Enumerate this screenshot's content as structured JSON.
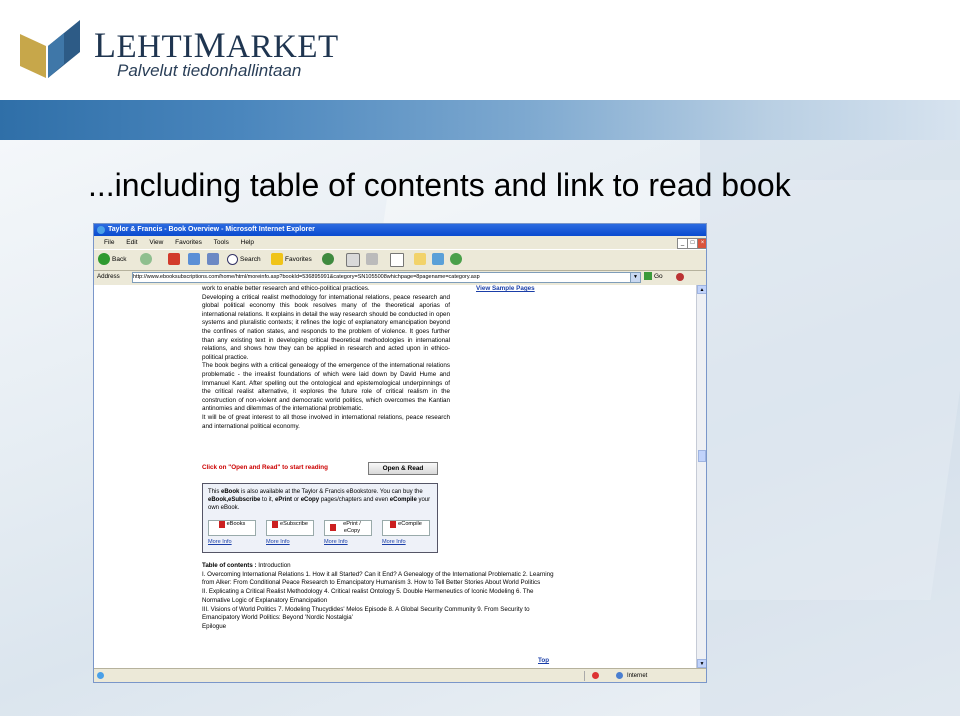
{
  "logo": {
    "brand": "LEHTIMARKET",
    "brand_first": "L",
    "brand_mid": "EHTI",
    "brand_second": "M",
    "brand_end": "ARKET",
    "tagline": "Palvelut tiedonhallintaan"
  },
  "slide": {
    "title": "...including table of contents and link to read book"
  },
  "browser": {
    "window_title": "Taylor & Francis - Book Overview - Microsoft Internet Explorer",
    "menu": [
      "File",
      "Edit",
      "View",
      "Favorites",
      "Tools",
      "Help"
    ],
    "toolbar": {
      "back": "Back",
      "search": "Search",
      "favorites": "Favorites"
    },
    "address_label": "Address",
    "url": "http://www.ebooksubscriptions.com/home/html/moreinfo.asp?bookId=536895991&category=SN1055008whichpage=8pagename=category.asp",
    "go_label": "Go",
    "status": {
      "zone": "Internet"
    }
  },
  "page": {
    "view_sample": "View Sample Pages",
    "description": [
      "work to enable better research and ethico-political practices.",
      "Developing a critical realist methodology for international relations, peace research and global political economy this book resolves many of the theoretical aporias of international relations. It explains in detail the way research should be conducted in open systems and pluralistic contexts; it refines the logic of explanatory emancipation beyond the confines of nation states, and responds to the problem of violence. It goes further than any existing text in developing critical theoretical methodologies in international relations, and shows how they can be applied in research and acted upon in ethico-political practice.",
      "The book begins with a critical genealogy of the emergence of the international relations problematic - the irrealist foundations of which were laid down by David Hume and Immanuel Kant. After spelling out the ontological and epistemological underpinnings of the critical realist alternative, it explores the future role of critical realism in the construction of non-violent and democratic world politics, which overcomes the Kantian antinomies and dilemmas of the international problematic.",
      "It will be of great interest to all those involved in international relations, peace research and international political economy."
    ],
    "open_read_prompt": "Click on \"Open and Read\" to start reading",
    "open_read_button": "Open & Read",
    "ebook_box": {
      "intro_1": "This ",
      "intro_ebook": "eBook",
      "intro_2": " is also available at the Taylor & Francis eBookstore. You can buy the ",
      "intro_bold": "eBook,eSubscribe",
      "intro_3": " to it, ",
      "intro_eprint": "ePrint",
      "intro_4": " or ",
      "intro_ecopy": "eCopy",
      "intro_5": " pages/chapters and even ",
      "intro_ecompile": "eCompile",
      "intro_6": " your own eBook.",
      "buttons": [
        {
          "label": "eBooks",
          "more": "More Info"
        },
        {
          "label": "eSubscribe",
          "more": "More Info"
        },
        {
          "label": "ePrint / eCopy",
          "more": "More Info"
        },
        {
          "label": "eCompile",
          "more": "More Info"
        }
      ]
    },
    "toc_heading": "Table of contents : ",
    "toc_intro": "Introduction",
    "toc_lines": [
      "I. Overcoming International Relations 1. How it all Started? Can it End? A Genealogy of the International Problematic 2. Learning from Alker: From Conditional Peace Research to Emancipatory Humanism 3. How to Tell Better Stories About World Politics",
      "II. Explicating a Critical Realist Methodology 4. Critical realist Ontology 5. Double Hermeneutics of Iconic Modeling 6. The Normative Logic of Explanatory Emancipation",
      "III. Visions of World Politics 7. Modeling Thucydides' Melos Episode 8. A Global Security Community 9. From Security to Emancipatory World Politics: Beyond 'Nordic Nostalgia'",
      "Epilogue"
    ],
    "top_link": "Top"
  },
  "colors": {
    "brand_navy": "#1f3550",
    "logo_gold": "#c7a74a",
    "band_blue": "#2f6fa8",
    "link_blue": "#1a3ea8",
    "prompt_red": "#cc0000"
  }
}
